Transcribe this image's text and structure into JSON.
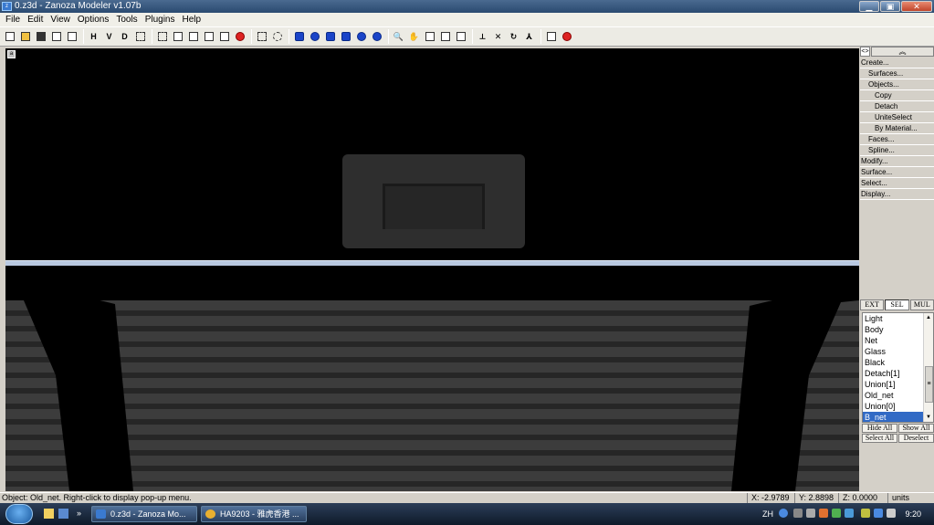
{
  "window": {
    "title": "0.z3d - Zanoza Modeler v1.07b",
    "app_icon": "z3d-icon",
    "buttons": [
      "minimize-icon",
      "maximize-icon",
      "close-icon"
    ]
  },
  "menu": [
    "File",
    "Edit",
    "View",
    "Options",
    "Tools",
    "Plugins",
    "Help"
  ],
  "toolbar": {
    "view_labels": {
      "h": "H",
      "v": "V",
      "d": "D"
    }
  },
  "viewport": {
    "corner_button": "a",
    "background": "#000000",
    "divider_color": "#b8c8e0"
  },
  "panel": {
    "pin": "<>",
    "collapse": "︽",
    "tree": [
      {
        "label": "Create...",
        "level": 0
      },
      {
        "label": "Surfaces...",
        "level": 1
      },
      {
        "label": "Objects...",
        "level": 1
      },
      {
        "label": "Copy",
        "level": 2
      },
      {
        "label": "Detach",
        "level": 2
      },
      {
        "label": "UniteSelect",
        "level": 2
      },
      {
        "label": "By Material...",
        "level": 2
      },
      {
        "label": "Faces...",
        "level": 1
      },
      {
        "label": "Spline...",
        "level": 1
      },
      {
        "label": "Modify...",
        "level": 0
      },
      {
        "label": "Surface...",
        "level": 0
      },
      {
        "label": "Select...",
        "level": 0
      },
      {
        "label": "Display...",
        "level": 0
      }
    ],
    "tabs": [
      "EXT",
      "SEL",
      "MUL"
    ],
    "active_tab": "SEL",
    "layers": [
      "Light",
      "Body",
      "Net",
      "Glass",
      "Black",
      "Detach[1]",
      "Union[1]",
      "Old_net",
      "Union[0]",
      "B_net"
    ],
    "selected_layer": "B_net",
    "buttons": {
      "hide_all": "Hide All",
      "show_all": "Show All",
      "select_all": "Select All",
      "deselect": "Deselect"
    },
    "selected_color": "#316ac5"
  },
  "status": {
    "message": "Object: Old_net. Right-click to display pop-up menu.",
    "x": "X: -2.9789",
    "y": "Y: 2.8898",
    "z": "Z: 0.0000",
    "units": "units"
  },
  "taskbar": {
    "tasks": [
      {
        "label": "0.z3d - Zanoza Mo...",
        "icon": "z3d-icon"
      },
      {
        "label": "HA9203 - 雅虎香港 ...",
        "icon": "chrome-icon"
      }
    ],
    "lang": "ZH",
    "clock": "9:20"
  }
}
